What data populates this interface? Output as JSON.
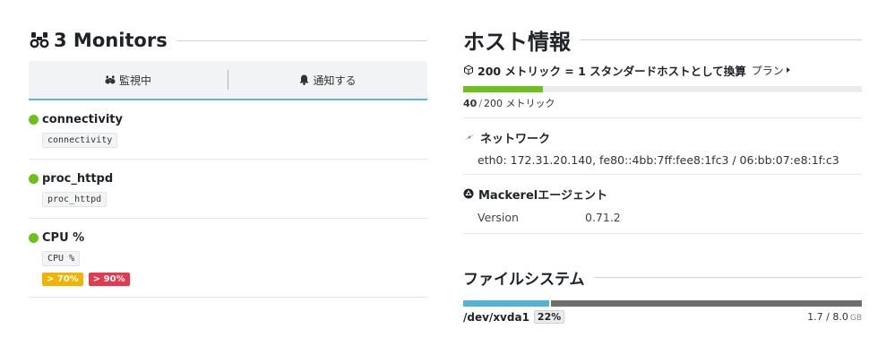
{
  "monitors": {
    "title": "3 Monitors",
    "tabs": [
      {
        "label": "監視中"
      },
      {
        "label": "通知する"
      }
    ],
    "items": [
      {
        "name": "connectivity",
        "code": "connectivity",
        "status_color": "#6ec01e"
      },
      {
        "name": "proc_httpd",
        "code": "proc_httpd",
        "status_color": "#6ec01e"
      },
      {
        "name": "CPU %",
        "code": "CPU %",
        "status_color": "#6ec01e",
        "warning": "> 70%",
        "critical": "> 90%"
      }
    ]
  },
  "host": {
    "title": "ホスト情報",
    "plan": {
      "formula": "200 メトリック = 1 スタンダードホストとして換算",
      "link": "プラン",
      "used": 40,
      "total": "200 メトリック",
      "fraction": 0.2,
      "bar_color": "#6ec01e"
    },
    "network": {
      "title": "ネットワーク",
      "line": "eth0: 172.31.20.140, fe80::4bb:7ff:fee8:1fc3 / 06:bb:07:e8:1f:c3"
    },
    "agent": {
      "title": "Mackerelエージェント",
      "key": "Version",
      "value": "0.71.2"
    }
  },
  "filesystem": {
    "title": "ファイルシステム",
    "device": "/dev/xvda1",
    "percent_label": "22%",
    "fraction": 0.22,
    "size": "1.7 / 8.0",
    "unit": "GB",
    "used_color": "#4fb3da",
    "free_color": "#6e6e6e"
  }
}
